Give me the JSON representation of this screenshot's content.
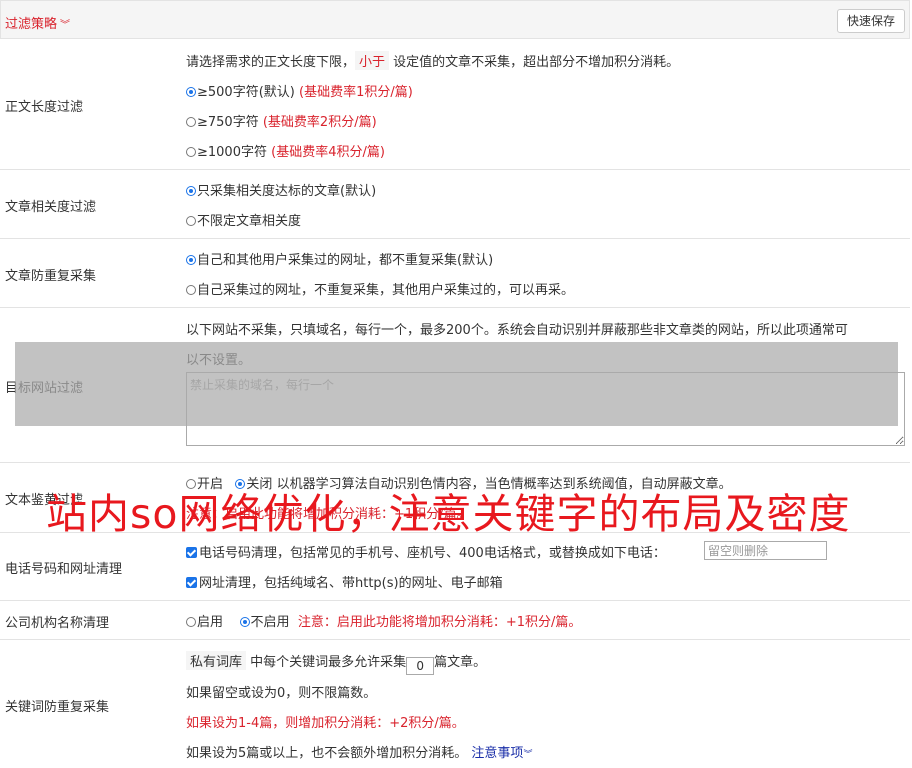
{
  "header": {
    "title": "过滤策略",
    "save_label": "快速保存"
  },
  "length_filter": {
    "label": "正文长度过滤",
    "desc_pre": "请选择需求的正文长度下限，",
    "desc_tag": "小于",
    "desc_post": "设定值的文章不采集，超出部分不增加积分消耗。",
    "options": [
      {
        "text": "≥500字符(默认)",
        "note": "(基础费率1积分/篇)"
      },
      {
        "text": "≥750字符",
        "note": "(基础费率2积分/篇)"
      },
      {
        "text": "≥1000字符",
        "note": "(基础费率4积分/篇)"
      }
    ]
  },
  "relevance_filter": {
    "label": "文章相关度过滤",
    "options": [
      "只采集相关度达标的文章(默认)",
      "不限定文章相关度"
    ]
  },
  "dedupe": {
    "label": "文章防重复采集",
    "options": [
      "自己和其他用户采集过的网址，都不重复采集(默认)",
      "自己采集过的网址，不重复采集，其他用户采集过的，可以再采。"
    ]
  },
  "site_filter": {
    "label": "目标网站过滤",
    "desc_line1": "以下网站不采集，只填域名，每行一个，最多200个。系统会自动识别并屏蔽那些非文章类的网站，所以此项通常可",
    "desc_line2": "以不设置。",
    "placeholder": "禁止采集的域名，每行一个"
  },
  "text_check": {
    "label": "文本鉴黄过滤",
    "opt_on": "开启",
    "opt_off": "关闭",
    "desc": "以机器学习算法自动识别色情内容，当色情概率达到系统阈值，自动屏蔽文章。",
    "note": "注意：启用此功能将增加积分消耗：+1积分/篇。"
  },
  "contact_clean": {
    "label": "电话号码和网址清理",
    "phone_text": "电话号码清理，包括常见的手机号、座机号、400电话格式，或替换成如下电话：",
    "phone_placeholder": "留空则删除",
    "url_text": "网址清理，包括纯域名、带http(s)的网址、电子邮箱"
  },
  "company_clean": {
    "label": "公司机构名称清理",
    "opt_on": "启用",
    "opt_off": "不启用",
    "note": "注意：启用此功能将增加积分消耗：+1积分/篇。"
  },
  "keyword_dedupe": {
    "label": "关键词防重复采集",
    "tag": "私有词库",
    "line1_mid": "中每个关键词最多允许采集",
    "value": "0",
    "line1_post": "篇文章。",
    "line2": "如果留空或设为0，则不限篇数。",
    "line3": "如果设为1-4篇，则增加积分消耗：+2积分/篇。",
    "line4": "如果设为5篇或以上，也不会额外增加积分消耗。",
    "link": "注意事项"
  },
  "watermark": "站内so网络优化，注意关键字的布局及密度"
}
